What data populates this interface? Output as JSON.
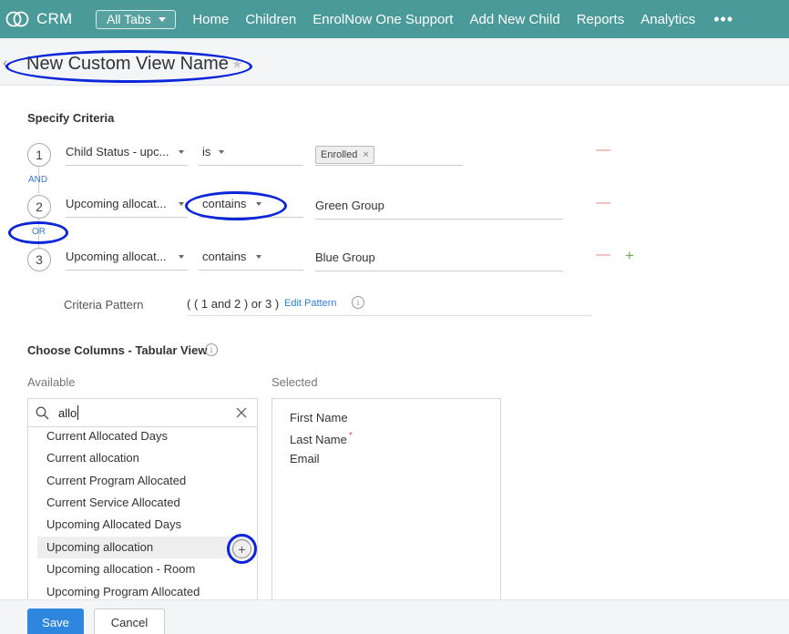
{
  "nav": {
    "brand": "CRM",
    "all_tabs": "All Tabs",
    "items": [
      "Home",
      "Children",
      "EnrolNow One Support",
      "Add New Child",
      "Reports",
      "Analytics"
    ],
    "more": "•••"
  },
  "header": {
    "back": "‹",
    "title": "New Custom View Name",
    "star": "★"
  },
  "criteria": {
    "section_title": "Specify Criteria",
    "rows": [
      {
        "num": "1",
        "field": "Child Status - upc...",
        "op": "is",
        "tag": "Enrolled",
        "tag_close": "×"
      },
      {
        "num": "2",
        "field": "Upcoming allocat...",
        "op": "contains",
        "value": "Green Group"
      },
      {
        "num": "3",
        "field": "Upcoming allocat...",
        "op": "contains",
        "value": "Blue Group"
      }
    ],
    "conj1": "AND",
    "conj2": "OR",
    "remove": "—",
    "add": "+",
    "pattern_label": "Criteria Pattern",
    "pattern_value": "( ( 1 and 2 ) or 3 )",
    "edit_pattern": "Edit Pattern",
    "info": "i"
  },
  "columns": {
    "section_title": "Choose Columns - Tabular View",
    "info": "i",
    "available_label": "Available",
    "selected_label": "Selected",
    "search_value": "allo",
    "available": [
      "Current Allocated Days",
      "Current allocation",
      "Current Program Allocated",
      "Current Service Allocated",
      "Upcoming Allocated Days",
      "Upcoming allocation",
      "Upcoming allocation - Room",
      "Upcoming Program Allocated"
    ],
    "add_icon": "+",
    "selected": [
      "First Name",
      "Last Name",
      "Email"
    ],
    "required_mark": "*"
  },
  "footer": {
    "save": "Save",
    "cancel": "Cancel"
  },
  "colors": {
    "nav_bg": "#4a9a9a",
    "annotation": "#0a26d8",
    "primary": "#2f86de",
    "link": "#2f7fd6"
  }
}
